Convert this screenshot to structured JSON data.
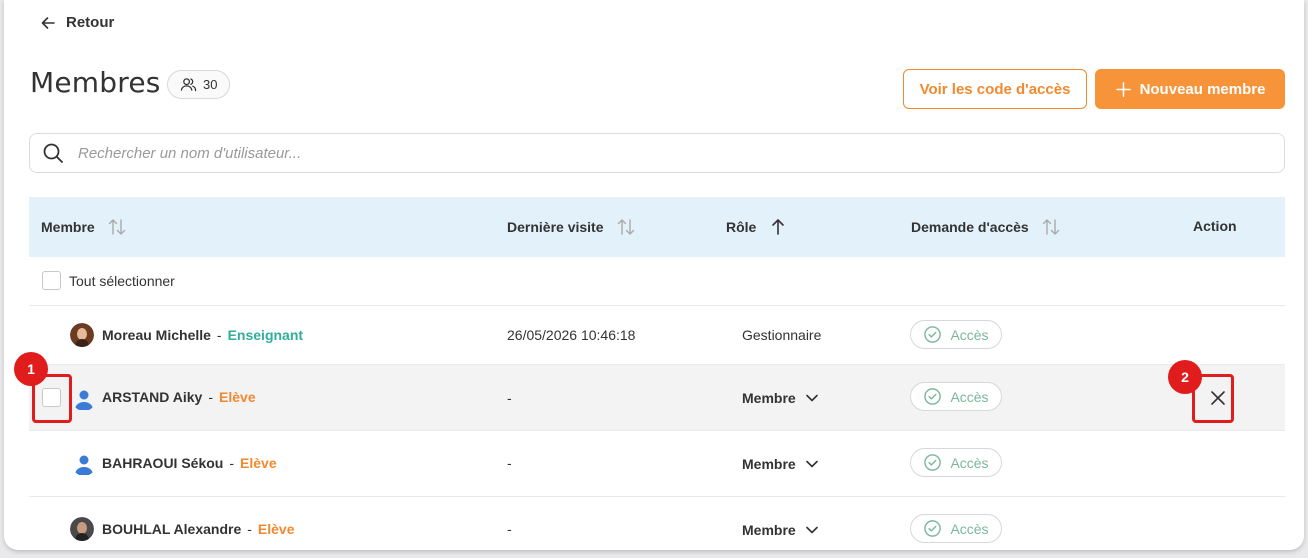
{
  "nav": {
    "back_label": "Retour"
  },
  "header": {
    "title": "Membres",
    "member_count": "30",
    "access_codes_button": "Voir les code d'accès",
    "new_member_button": "Nouveau membre"
  },
  "search": {
    "placeholder": "Rechercher un nom d'utilisateur..."
  },
  "table": {
    "columns": {
      "member": "Membre",
      "last_visit": "Dernière visite",
      "role": "Rôle",
      "access_request": "Demande d'accès",
      "action": "Action"
    },
    "select_all_label": "Tout sélectionner",
    "rows": [
      {
        "name": "Moreau Michelle",
        "separator": "-",
        "type": "Enseignant",
        "last_visit": "26/05/2026 10:46:18",
        "role": "Gestionnaire",
        "access": "Accès"
      },
      {
        "name": "ARSTAND Aiky",
        "separator": "-",
        "type": "Elève",
        "last_visit": "-",
        "role": "Membre",
        "access": "Accès"
      },
      {
        "name": "BAHRAOUI Sékou",
        "separator": "-",
        "type": "Elève",
        "last_visit": "-",
        "role": "Membre",
        "access": "Accès"
      },
      {
        "name": "BOUHLAL Alexandre",
        "separator": "-",
        "type": "Elève",
        "last_visit": "-",
        "role": "Membre",
        "access": "Accès"
      }
    ]
  },
  "annotations": {
    "marker_1": "1",
    "marker_2": "2"
  },
  "colors": {
    "accent_orange": "#f7943a",
    "teacher_teal": "#2fae9c",
    "access_green": "#7bb89a",
    "annotation_red": "#e01c1c",
    "header_blue": "#e3f1fb"
  },
  "icons": {
    "back": "arrow-left-icon",
    "members": "users-icon",
    "plus": "plus-icon",
    "search": "search-icon",
    "sort": "sort-icon",
    "sort_up": "arrow-up-icon",
    "chevron": "chevron-down-icon",
    "check": "check-circle-icon",
    "close": "close-icon",
    "user": "user-icon"
  }
}
